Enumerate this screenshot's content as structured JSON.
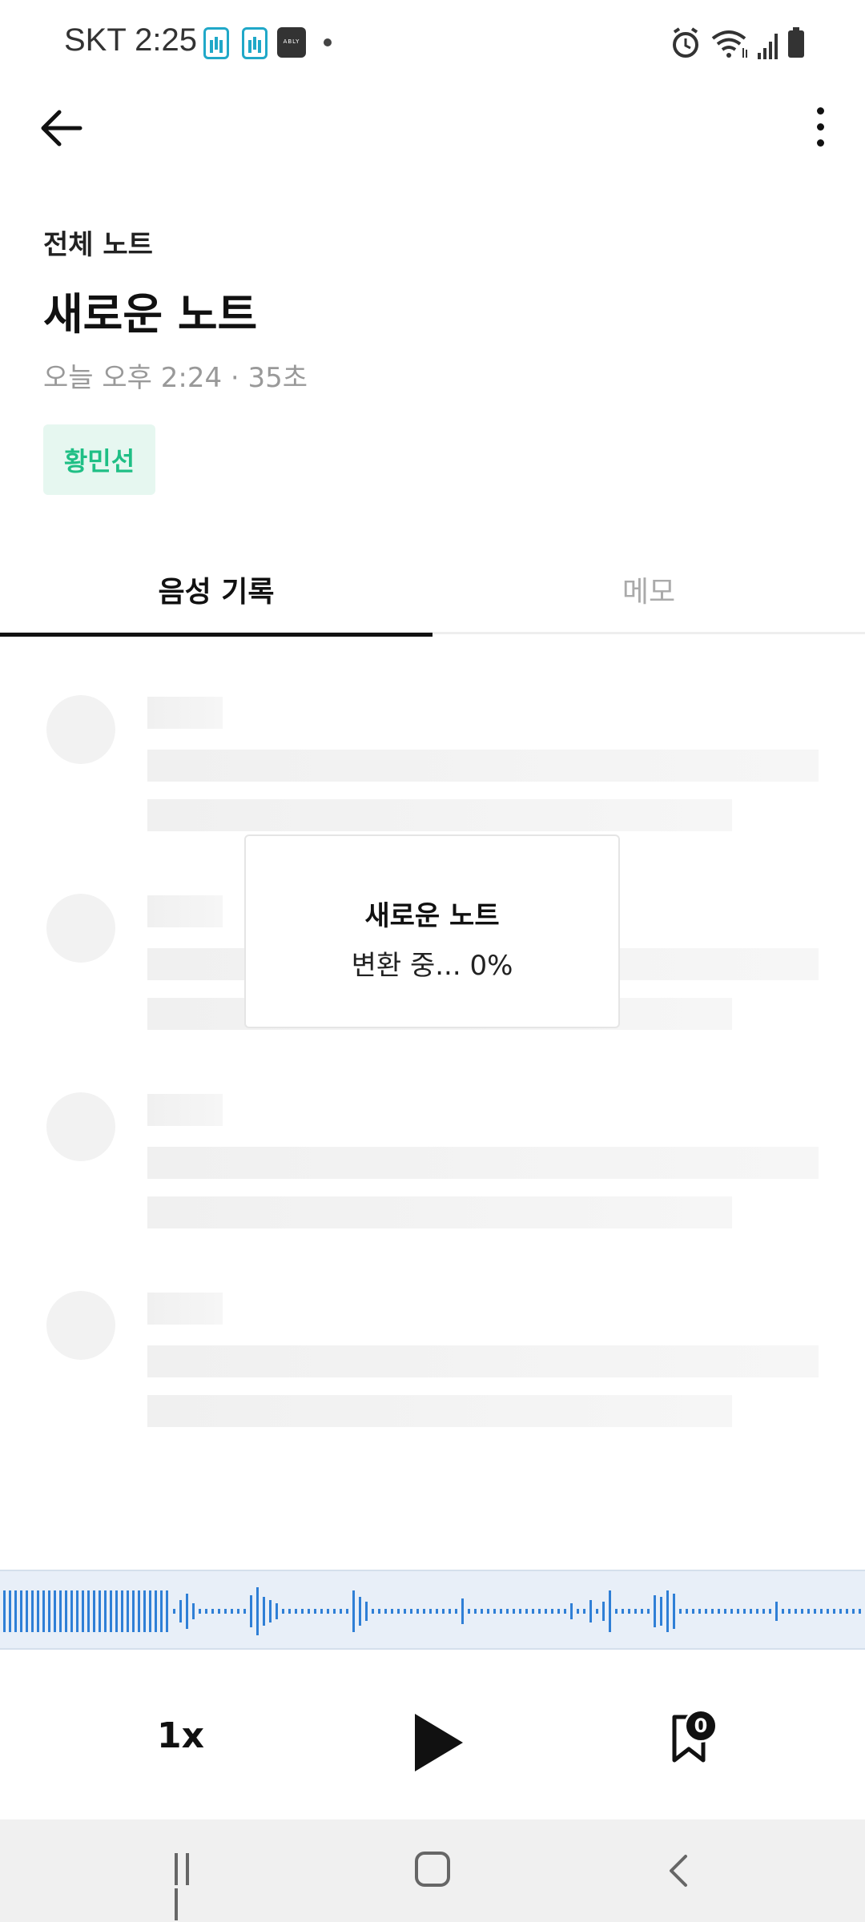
{
  "status_bar": {
    "carrier_time": "SKT 2:25",
    "notification_icons": [
      "voice-recorder-icon",
      "voice-recorder-icon",
      "ably-app-icon"
    ],
    "right_icons": [
      "alarm-icon",
      "wifi-icon",
      "signal-icon",
      "battery-icon"
    ],
    "ably_label": "ABLY"
  },
  "header": {
    "back_icon": "back-arrow-icon",
    "more_icon": "more-vertical-icon"
  },
  "note": {
    "folder": "전체 노트",
    "title": "새로운 노트",
    "meta": "오늘 오후 2:24 · 35초",
    "speaker_tag": "황민선",
    "tag_color": "#1fbf85"
  },
  "tabs": [
    {
      "label": "음성 기록",
      "active": true
    },
    {
      "label": "메모",
      "active": false
    }
  ],
  "dialog": {
    "title": "새로운 노트",
    "progress_text": "변환 중... 0%"
  },
  "player": {
    "speed": "1x",
    "play_icon": "play-icon",
    "bookmark_icon": "bookmark-icon",
    "bookmark_count": "0",
    "waveform_color": "#2f7fd6"
  },
  "nav_bar": {
    "icons": [
      "recents-icon",
      "home-icon",
      "back-icon"
    ]
  }
}
